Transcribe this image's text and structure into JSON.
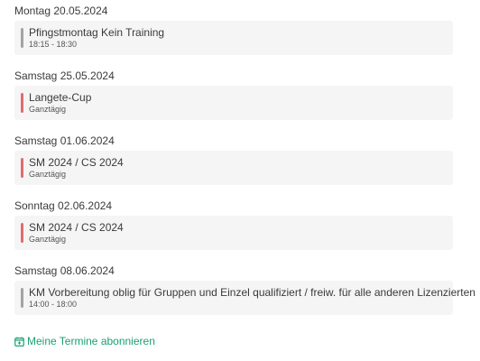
{
  "colors": {
    "bar_gray": "#a3a3a3",
    "bar_red": "#e06b6f",
    "link_green": "#1aa071",
    "card_bg": "#f5f5f5"
  },
  "days": [
    {
      "date": "Montag 20.05.2024",
      "event": {
        "title": "Pfingstmontag Kein Training",
        "time": "18:15 - 18:30",
        "bar": "gray"
      }
    },
    {
      "date": "Samstag 25.05.2024",
      "event": {
        "title": "Langete-Cup",
        "time": "Ganztägig",
        "bar": "red"
      }
    },
    {
      "date": "Samstag 01.06.2024",
      "event": {
        "title": "SM 2024 / CS 2024",
        "time": "Ganztägig",
        "bar": "red"
      }
    },
    {
      "date": "Sonntag 02.06.2024",
      "event": {
        "title": "SM 2024 / CS 2024",
        "time": "Ganztägig",
        "bar": "red"
      }
    },
    {
      "date": "Samstag 08.06.2024",
      "event": {
        "title": "KM Vorbereitung oblig für Gruppen und Einzel qualifiziert / freiw. für alle anderen Lizenzierten",
        "time": "14:00 - 18:00",
        "bar": "gray"
      }
    }
  ],
  "subscribe": {
    "icon": "calendar-plus-icon",
    "label": "Meine Termine abonnieren"
  }
}
